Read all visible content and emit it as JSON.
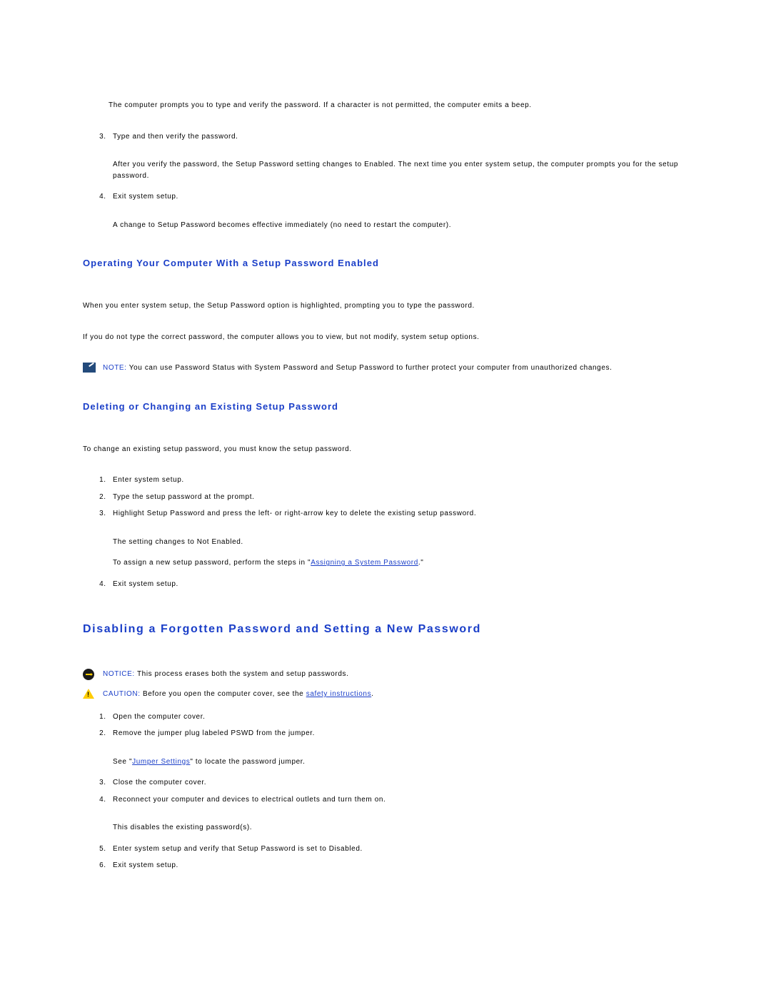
{
  "intro": {
    "p1": "The computer prompts you to type and verify the password. If a character is not permitted, the computer emits a beep."
  },
  "list1": {
    "item3": "Type and then verify the password.",
    "after3": "After you verify the password, the Setup Password setting changes to Enabled. The next time you enter system setup, the computer prompts you for the setup password.",
    "item4": "Exit system setup.",
    "after4": "A change to Setup Password becomes effective immediately (no need to restart the computer)."
  },
  "section1": {
    "heading": "Operating Your Computer With a Setup Password Enabled",
    "p1": "When you enter system setup, the Setup Password option is highlighted, prompting you to type the password.",
    "p2": "If you do not type the correct password, the computer allows you to view, but not modify, system setup options.",
    "note_label": "NOTE:",
    "note_text": " You can use Password Status with System Password and Setup Password to further protect your computer from unauthorized changes."
  },
  "section2": {
    "heading": "Deleting or Changing an Existing Setup Password",
    "p1": "To change an existing setup password, you must know the setup password.",
    "item1": "Enter system setup.",
    "item2": "Type the setup password at the prompt.",
    "item3": "Highlight Setup Password and press the left- or right-arrow key to delete the existing setup password.",
    "after3a": "The setting changes to Not Enabled.",
    "after3b_pre": "To assign a new setup password, perform the steps in \"",
    "after3b_link": "Assigning a System Password",
    "after3b_post": ".\"",
    "item4": "Exit system setup."
  },
  "section3": {
    "heading": "Disabling a Forgotten Password and Setting a New Password",
    "notice_label": "NOTICE:",
    "notice_text": " This process erases both the system and setup passwords.",
    "caution_label": "CAUTION:",
    "caution_pre": " Before you open the computer cover, see the ",
    "caution_link": "safety instructions",
    "caution_post": ".",
    "item1": "Open the computer cover.",
    "item2": "Remove the jumper plug labeled PSWD from the jumper.",
    "after2_pre": "See \"",
    "after2_link": "Jumper Settings",
    "after2_post": "\" to locate the password jumper.",
    "item3": "Close the computer cover.",
    "item4": "Reconnect your computer and devices to electrical outlets and turn them on.",
    "after4": "This disables the existing password(s).",
    "item5": "Enter system setup and verify that Setup Password is set to Disabled.",
    "item6": "Exit system setup."
  }
}
